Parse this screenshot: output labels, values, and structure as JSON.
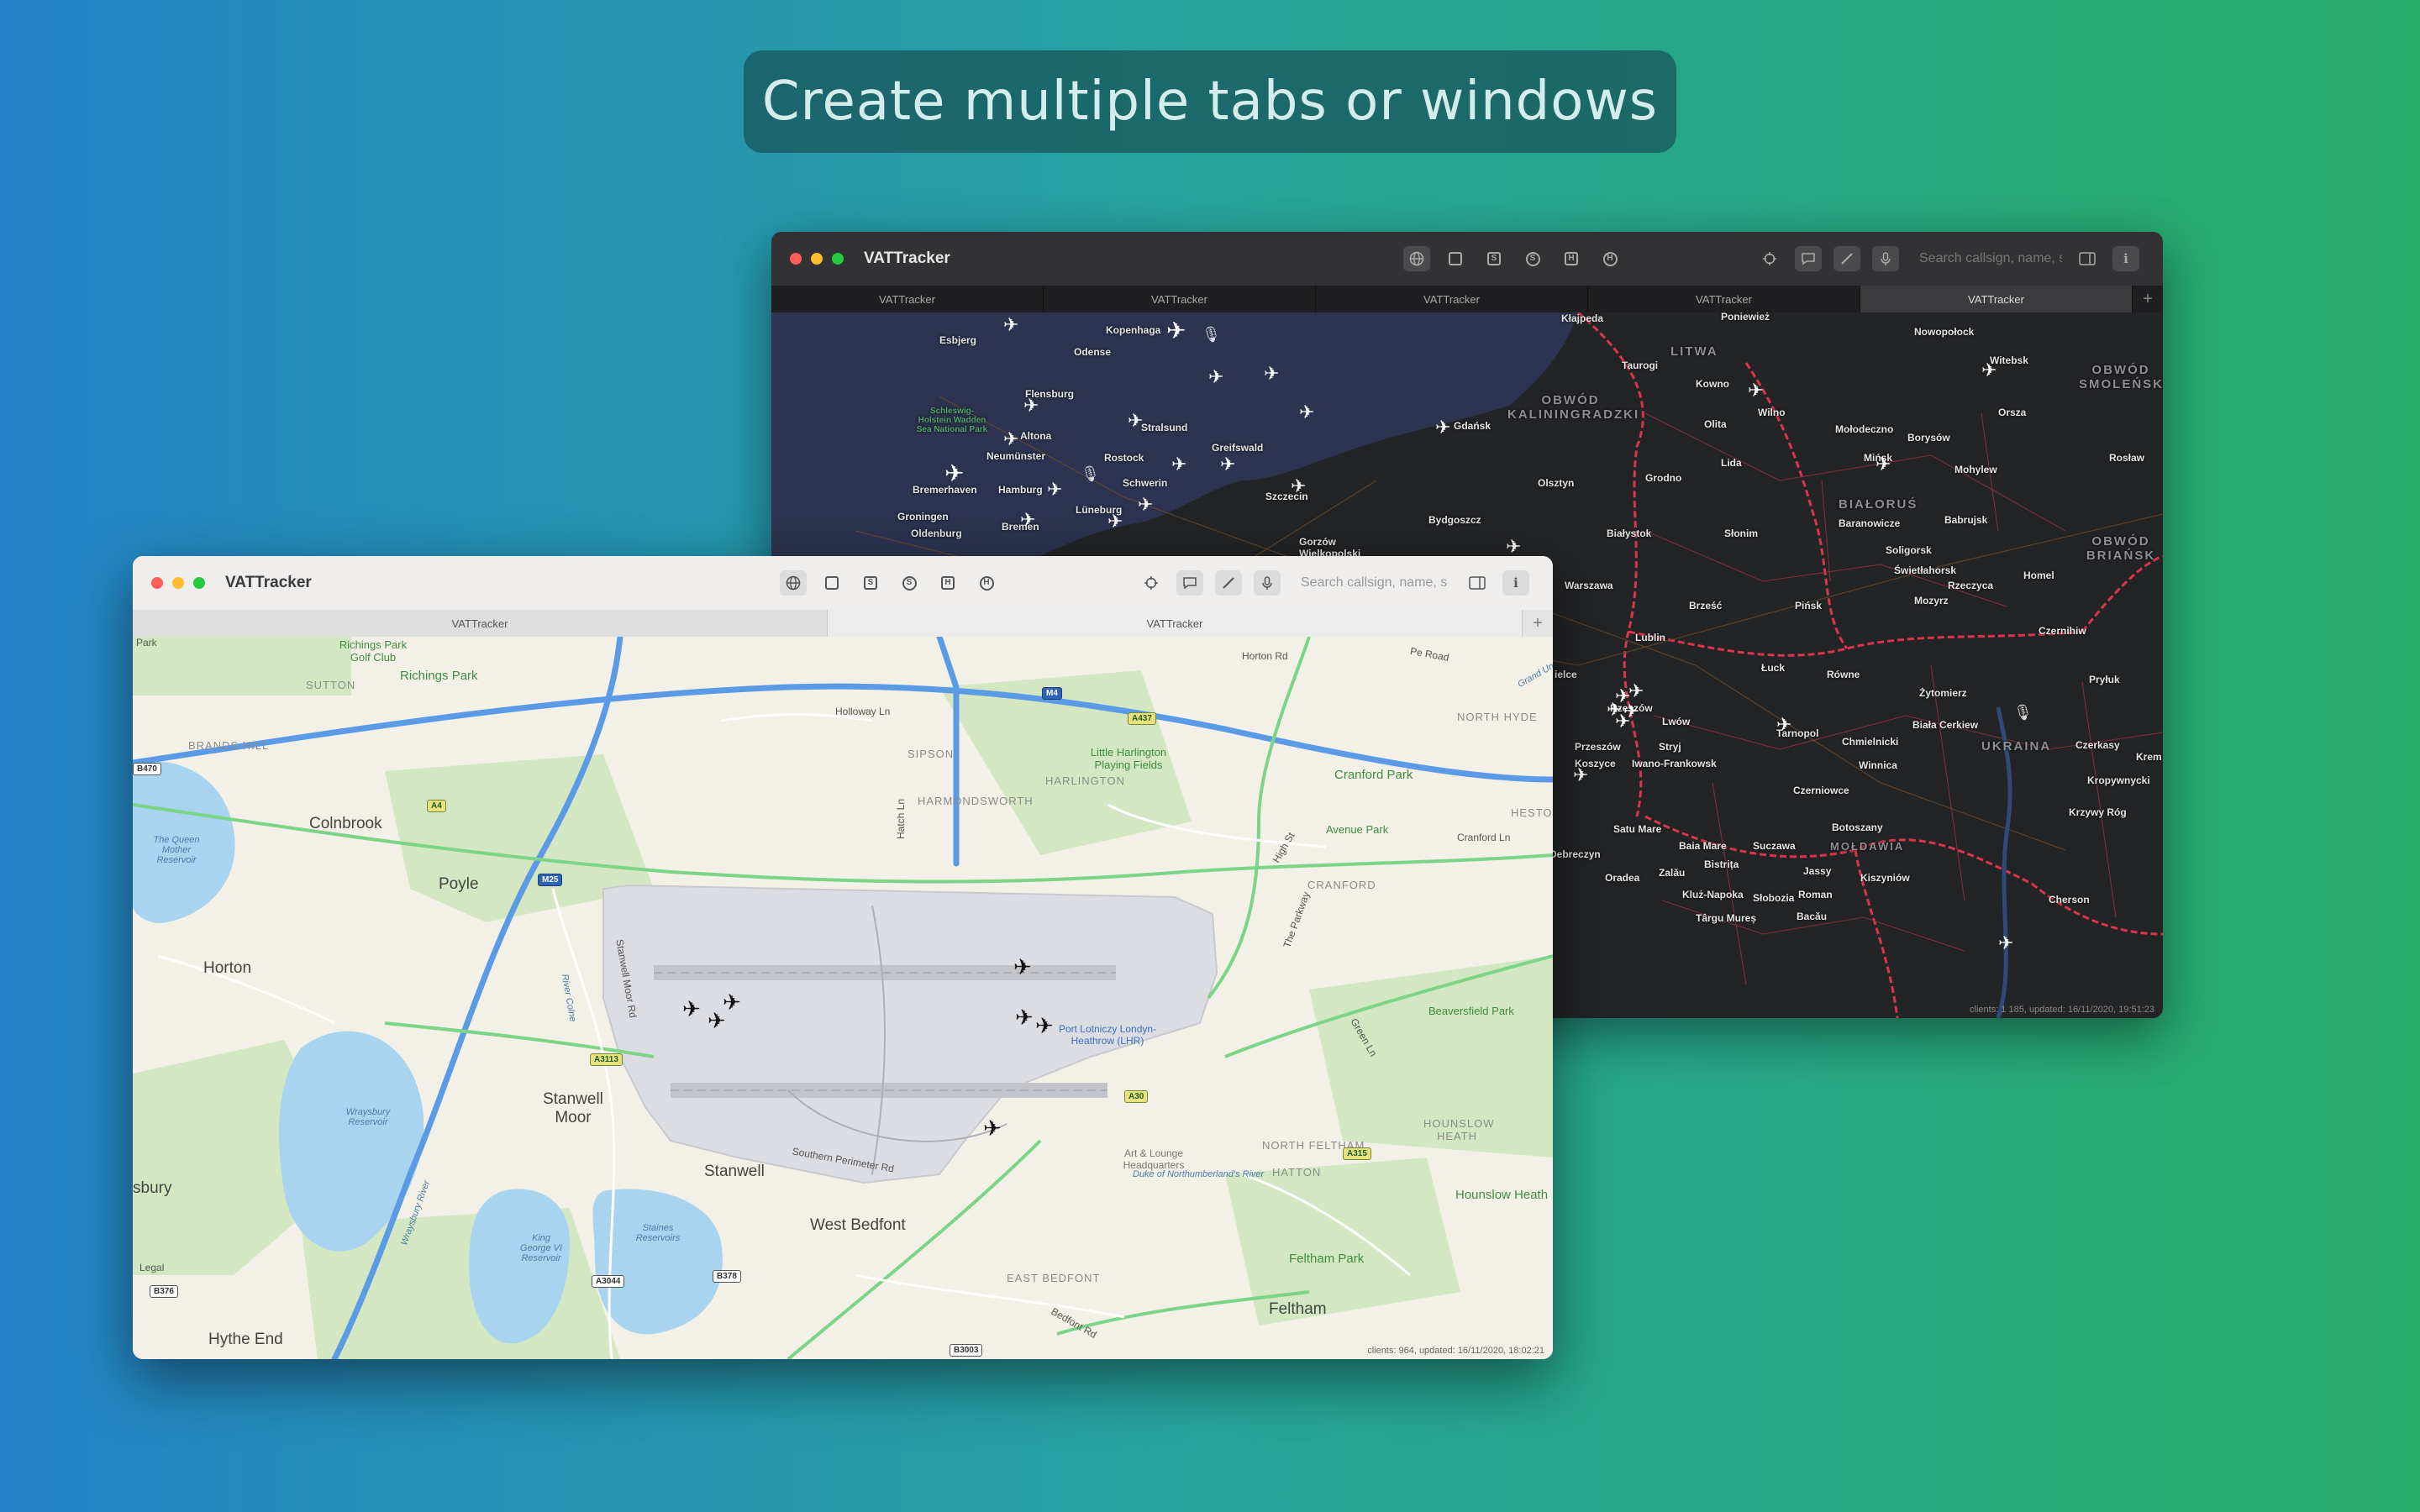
{
  "banner": {
    "text": "Create multiple tabs or windows"
  },
  "window_dark": {
    "title": "VATTracker",
    "search_placeholder": "Search callsign, name, s",
    "tabs": [
      "VATTracker",
      "VATTracker",
      "VATTracker",
      "VATTracker",
      "VATTracker"
    ],
    "active_tab_index": 4,
    "footer": "clients: 1 185, updated: 16/11/2020, 19:51:23",
    "labels": {
      "esbjerg": "Esbjerg",
      "odense": "Odense",
      "kopenhaga": "Kopenhaga",
      "flensburg": "Flensburg",
      "wadden": "Schleswig-Holstein Wadden Sea National Park",
      "altona": "Altona",
      "stralsund": "Stralsund",
      "greifswald": "Greifswald",
      "neumunster": "Neumünster",
      "rostock": "Rostock",
      "schwerin": "Schwerin",
      "bremerhaven": "Bremerhaven",
      "hamburg": "Hamburg",
      "luneburg": "Lüneburg",
      "szczecin": "Szczecin",
      "groningen": "Groningen",
      "oldenburg": "Oldenburg",
      "bremen": "Bremen",
      "gorzow": "Gorzów Wielkopolski",
      "bydgoszcz": "Bydgoszcz",
      "gdansk": "Gdańsk",
      "klajpeda": "Kłajpeda",
      "poniewiez": "Poniewież",
      "nowopolock": "Nowopołock",
      "witebsk": "Witebsk",
      "litwa": "LITWA",
      "taurogi": "Taurogi",
      "kowno": "Kowno",
      "wilno": "Wilno",
      "olita": "Olita",
      "orsza": "Orsza",
      "obwod_kal": "OBWÓD KALININGRADZKI",
      "obwod_smol": "OBWÓD SMOLEŃSKI",
      "molodeczno": "Mołodeczno",
      "borysow": "Borysów",
      "lida": "Lida",
      "minsk": "Mińsk",
      "mohylew": "Mohylew",
      "roslaw": "Rosław",
      "olsztyn": "Olsztyn",
      "grodno": "Grodno",
      "bialorus": "BIAŁORUŚ",
      "baranowicze": "Baranowicze",
      "babrujsk": "Babrujsk",
      "bialystok": "Białystok",
      "slonim": "Słonim",
      "soligorsk": "Soligorsk",
      "swietlahorsk": "Świetłahorsk",
      "obwod_brian": "OBWÓD BRIAŃSK",
      "warszawa": "Warszawa",
      "rzeczyca": "Rzeczyca",
      "brzesc": "Brześć",
      "pinsk": "Pińsk",
      "mozyrz": "Mozyrz",
      "homel": "Homel",
      "lublin": "Lublin",
      "czernihiw": "Czernihiw",
      "luck": "Łuck",
      "rowne": "Równe",
      "kielce": "ielce",
      "rzeszow": "Rzeszów",
      "zytomierz": "Żytomierz",
      "pryluk": "Pryłuk",
      "lwow": "Lwów",
      "tarnopol": "Tarnopol",
      "chmielnicki": "Chmielnicki",
      "bialacerkiew": "Biała Cerkiew",
      "ukraina": "UKRAINA",
      "czerkasy": "Czerkasy",
      "krem": "Krem",
      "przesow": "Przeszów",
      "stryj": "Stryj",
      "koszyce": "Koszyce",
      "iwanofr": "Iwano-Frankowsk",
      "winnica": "Winnica",
      "kropywnycki": "Kropywnycki",
      "czerniowce": "Czerniowce",
      "krzywyrog": "Krzywy Róg",
      "botoszany": "Botoszany",
      "satumare": "Satu Mare",
      "baiamare": "Baia Mare",
      "suczawa": "Suczawa",
      "moldawia": "MOŁDAWIA",
      "debreczyn": "Debreczyn",
      "bistrita": "Bistrița",
      "jassy": "Jassy",
      "kiszyniow": "Kiszyniów",
      "oradea": "Oradea",
      "zalau": "Zalău",
      "klujnapoka": "Kluż-Napoka",
      "slobozia": "Słobozia",
      "roman": "Roman",
      "cherson": "Cherson",
      "targumures": "Târgu Mureș",
      "bacau": "Bacău"
    }
  },
  "window_light": {
    "title": "VATTracker",
    "search_placeholder": "Search callsign, name, s",
    "tabs": [
      "VATTracker",
      "VATTracker"
    ],
    "active_tab_index": 1,
    "footer": "clients: 964, updated: 16/11/2020, 18:02:21",
    "labels": {
      "park": "Park",
      "richings_golf": "Richings Park Golf Club",
      "richings_park": "Richings Park",
      "sutton": "SUTTON",
      "brands_hill": "BRANDS HILL",
      "colnbrook": "Colnbrook",
      "poyle": "Poyle",
      "horton": "Horton",
      "queen_mother": "The Queen Mother Reservoir",
      "sipson": "SIPSON",
      "little_harlington": "Little Harlington Playing Fields",
      "harlington": "HARLINGTON",
      "harmondsworth": "HARMONDSWORTH",
      "holloway": "Holloway Ln",
      "hatch": "Hatch Ln",
      "cranford_park": "Cranford Park",
      "north_hyde": "NORTH HYDE",
      "heston": "HESTO",
      "avenue_park": "Avenue Park",
      "high_st": "High St",
      "cranford_ln": "Cranford Ln",
      "cranford": "CRANFORD",
      "the_parkway": "The Parkway",
      "stanwell_moor_rd": "Stanwell Moor Rd",
      "river_colne": "River Colne",
      "stanwell_moor": "Stanwell Moor",
      "wraysbury": "Wraysbury Reservoir",
      "sbury": "sbury",
      "airport": "Port Lotniczy Londyn-Heathrow (LHR)",
      "southern_perimeter": "Southern Perimeter Rd",
      "art_lounge": "Art & Lounge Headquarters",
      "stanwell": "Stanwell",
      "west_bedfont": "West Bedfont",
      "north_feltham": "NORTH FELTHAM",
      "hatton": "HATTON",
      "hounslow_heath_area": "HOUNSLOW HEATH",
      "hounslow_heath": "Hounslow Heath",
      "beavers_park": "Beaversfield Park",
      "duke_river": "Duke of Northumberland's River",
      "green_ln": "Green Ln",
      "feltham_park": "Feltham Park",
      "feltham": "Feltham",
      "east_bedfont": "EAST BEDFONT",
      "bedfont_rd": "Bedfont Rd",
      "king_george": "King George VI Reservoir",
      "staines": "Staines Reservoirs",
      "hythe_end": "Hythe End",
      "legal": "Legal",
      "pe_road": "Pe Road",
      "grand_un": "Grand Un",
      "horton_rd": "Horton Rd",
      "wraysbury_river": "Wraysbury River"
    },
    "road_shields": {
      "m4": "M4",
      "a437": "A437",
      "b470": "B470",
      "a4": "A4",
      "m25": "M25",
      "a3113": "A3113",
      "a30": "A30",
      "a315": "A315",
      "a3044": "A3044",
      "b378": "B378",
      "b376": "B376",
      "b3003": "B3003"
    }
  },
  "icons": {
    "globe": "globe-icon",
    "square": "square-icon",
    "s_box": "s-box-icon",
    "dollar": "circle-s-icon",
    "h_box": "h-box-icon",
    "h_circle": "h-circle-icon",
    "crosshair": "crosshair-icon",
    "chat": "chat-bubble-icon",
    "ruler": "ruler-icon",
    "mic": "microphone-icon",
    "sidebar": "sidebar-icon",
    "info": "info-icon"
  },
  "colors": {
    "accent_road": "#5b9be6",
    "park": "#c9e5b5",
    "water": "#a8d3f0",
    "route_border": "#d9354f"
  }
}
